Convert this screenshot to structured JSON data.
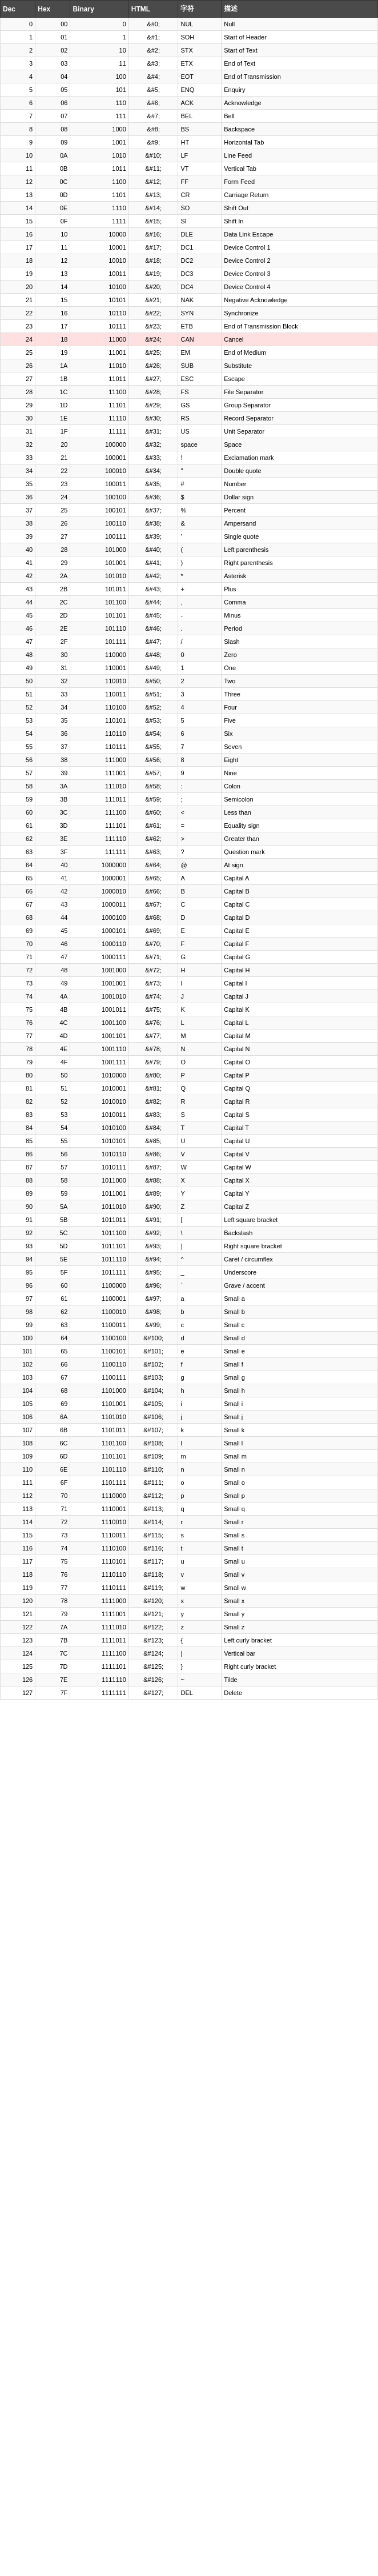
{
  "table": {
    "headers": [
      "Dec",
      "Hex",
      "Binary",
      "HTML",
      "字符",
      "描述"
    ],
    "rows": [
      [
        0,
        "00",
        "0",
        "&#0;",
        "NUL",
        "Null"
      ],
      [
        1,
        "01",
        "1",
        "&#1;",
        "SOH",
        "Start of Header"
      ],
      [
        2,
        "02",
        "10",
        "&#2;",
        "STX",
        "Start of Text"
      ],
      [
        3,
        "03",
        "11",
        "&#3;",
        "ETX",
        "End of Text"
      ],
      [
        4,
        "04",
        "100",
        "&#4;",
        "EOT",
        "End of Transmission"
      ],
      [
        5,
        "05",
        "101",
        "&#5;",
        "ENQ",
        "Enquiry"
      ],
      [
        6,
        "06",
        "110",
        "&#6;",
        "ACK",
        "Acknowledge"
      ],
      [
        7,
        "07",
        "111",
        "&#7;",
        "BEL",
        "Bell"
      ],
      [
        8,
        "08",
        "1000",
        "&#8;",
        "BS",
        "Backspace"
      ],
      [
        9,
        "09",
        "1001",
        "&#9;",
        "HT",
        "Horizontal Tab"
      ],
      [
        10,
        "0A",
        "1010",
        "&#10;",
        "LF",
        "Line Feed"
      ],
      [
        11,
        "0B",
        "1011",
        "&#11;",
        "VT",
        "Vertical Tab"
      ],
      [
        12,
        "0C",
        "1100",
        "&#12;",
        "FF",
        "Form Feed"
      ],
      [
        13,
        "0D",
        "1101",
        "&#13;",
        "CR",
        "Carriage Return"
      ],
      [
        14,
        "0E",
        "1110",
        "&#14;",
        "SO",
        "Shift Out"
      ],
      [
        15,
        "0F",
        "1111",
        "&#15;",
        "SI",
        "Shift In"
      ],
      [
        16,
        "10",
        "10000",
        "&#16;",
        "DLE",
        "Data Link Escape"
      ],
      [
        17,
        "11",
        "10001",
        "&#17;",
        "DC1",
        "Device Control 1"
      ],
      [
        18,
        "12",
        "10010",
        "&#18;",
        "DC2",
        "Device Control 2"
      ],
      [
        19,
        "13",
        "10011",
        "&#19;",
        "DC3",
        "Device Control 3"
      ],
      [
        20,
        "14",
        "10100",
        "&#20;",
        "DC4",
        "Device Control 4"
      ],
      [
        21,
        "15",
        "10101",
        "&#21;",
        "NAK",
        "Negative Acknowledge"
      ],
      [
        22,
        "16",
        "10110",
        "&#22;",
        "SYN",
        "Synchronize"
      ],
      [
        23,
        "17",
        "10111",
        "&#23;",
        "ETB",
        "End of Transmission Block"
      ],
      [
        24,
        "18",
        "11000",
        "&#24;",
        "CAN",
        "Cancel"
      ],
      [
        25,
        "19",
        "11001",
        "&#25;",
        "EM",
        "End of Medium"
      ],
      [
        26,
        "1A",
        "11010",
        "&#26;",
        "SUB",
        "Substitute"
      ],
      [
        27,
        "1B",
        "11011",
        "&#27;",
        "ESC",
        "Escape"
      ],
      [
        28,
        "1C",
        "11100",
        "&#28;",
        "FS",
        "File Separator"
      ],
      [
        29,
        "1D",
        "11101",
        "&#29;",
        "GS",
        "Group Separator"
      ],
      [
        30,
        "1E",
        "11110",
        "&#30;",
        "RS",
        "Record Separator"
      ],
      [
        31,
        "1F",
        "11111",
        "&#31;",
        "US",
        "Unit Separator"
      ],
      [
        32,
        "20",
        "100000",
        "&#32;",
        "space",
        "Space"
      ],
      [
        33,
        "21",
        "100001",
        "&#33;",
        "!",
        "Exclamation mark"
      ],
      [
        34,
        "22",
        "100010",
        "&#34;",
        "\"",
        "Double quote"
      ],
      [
        35,
        "23",
        "100011",
        "&#35;",
        "#",
        "Number"
      ],
      [
        36,
        "24",
        "100100",
        "&#36;",
        "$",
        "Dollar sign"
      ],
      [
        37,
        "25",
        "100101",
        "&#37;",
        "%",
        "Percent"
      ],
      [
        38,
        "26",
        "100110",
        "&#38;",
        "&",
        "Ampersand"
      ],
      [
        39,
        "27",
        "100111",
        "&#39;",
        "'",
        "Single quote"
      ],
      [
        40,
        "28",
        "101000",
        "&#40;",
        "(",
        "Left parenthesis"
      ],
      [
        41,
        "29",
        "101001",
        "&#41;",
        ")",
        "Right parenthesis"
      ],
      [
        42,
        "2A",
        "101010",
        "&#42;",
        "*",
        "Asterisk"
      ],
      [
        43,
        "2B",
        "101011",
        "&#43;",
        "+",
        "Plus"
      ],
      [
        44,
        "2C",
        "101100",
        "&#44;",
        ",",
        "Comma"
      ],
      [
        45,
        "2D",
        "101101",
        "&#45;",
        "-",
        "Minus"
      ],
      [
        46,
        "2E",
        "101110",
        "&#46;",
        ".",
        "Period"
      ],
      [
        47,
        "2F",
        "101111",
        "&#47;",
        "/",
        "Slash"
      ],
      [
        48,
        "30",
        "110000",
        "&#48;",
        "0",
        "Zero"
      ],
      [
        49,
        "31",
        "110001",
        "&#49;",
        "1",
        "One"
      ],
      [
        50,
        "32",
        "110010",
        "&#50;",
        "2",
        "Two"
      ],
      [
        51,
        "33",
        "110011",
        "&#51;",
        "3",
        "Three"
      ],
      [
        52,
        "34",
        "110100",
        "&#52;",
        "4",
        "Four"
      ],
      [
        53,
        "35",
        "110101",
        "&#53;",
        "5",
        "Five"
      ],
      [
        54,
        "36",
        "110110",
        "&#54;",
        "6",
        "Six"
      ],
      [
        55,
        "37",
        "110111",
        "&#55;",
        "7",
        "Seven"
      ],
      [
        56,
        "38",
        "111000",
        "&#56;",
        "8",
        "Eight"
      ],
      [
        57,
        "39",
        "111001",
        "&#57;",
        "9",
        "Nine"
      ],
      [
        58,
        "3A",
        "111010",
        "&#58;",
        ":",
        "Colon"
      ],
      [
        59,
        "3B",
        "111011",
        "&#59;",
        ";",
        "Semicolon"
      ],
      [
        60,
        "3C",
        "111100",
        "&#60;",
        "<",
        "Less than"
      ],
      [
        61,
        "3D",
        "111101",
        "&#61;",
        "=",
        "Equality sign"
      ],
      [
        62,
        "3E",
        "111110",
        "&#62;",
        ">",
        "Greater than"
      ],
      [
        63,
        "3F",
        "111111",
        "&#63;",
        "?",
        "Question mark"
      ],
      [
        64,
        "40",
        "1000000",
        "&#64;",
        "@",
        "At sign"
      ],
      [
        65,
        "41",
        "1000001",
        "&#65;",
        "A",
        "Capital A"
      ],
      [
        66,
        "42",
        "1000010",
        "&#66;",
        "B",
        "Capital B"
      ],
      [
        67,
        "43",
        "1000011",
        "&#67;",
        "C",
        "Capital C"
      ],
      [
        68,
        "44",
        "1000100",
        "&#68;",
        "D",
        "Capital D"
      ],
      [
        69,
        "45",
        "1000101",
        "&#69;",
        "E",
        "Capital E"
      ],
      [
        70,
        "46",
        "1000110",
        "&#70;",
        "F",
        "Capital F"
      ],
      [
        71,
        "47",
        "1000111",
        "&#71;",
        "G",
        "Capital G"
      ],
      [
        72,
        "48",
        "1001000",
        "&#72;",
        "H",
        "Capital H"
      ],
      [
        73,
        "49",
        "1001001",
        "&#73;",
        "I",
        "Capital I"
      ],
      [
        74,
        "4A",
        "1001010",
        "&#74;",
        "J",
        "Capital J"
      ],
      [
        75,
        "4B",
        "1001011",
        "&#75;",
        "K",
        "Capital K"
      ],
      [
        76,
        "4C",
        "1001100",
        "&#76;",
        "L",
        "Capital L"
      ],
      [
        77,
        "4D",
        "1001101",
        "&#77;",
        "M",
        "Capital M"
      ],
      [
        78,
        "4E",
        "1001110",
        "&#78;",
        "N",
        "Capital N"
      ],
      [
        79,
        "4F",
        "1001111",
        "&#79;",
        "O",
        "Capital O"
      ],
      [
        80,
        "50",
        "1010000",
        "&#80;",
        "P",
        "Capital P"
      ],
      [
        81,
        "51",
        "1010001",
        "&#81;",
        "Q",
        "Capital Q"
      ],
      [
        82,
        "52",
        "1010010",
        "&#82;",
        "R",
        "Capital R"
      ],
      [
        83,
        "53",
        "1010011",
        "&#83;",
        "S",
        "Capital S"
      ],
      [
        84,
        "54",
        "1010100",
        "&#84;",
        "T",
        "Capital T"
      ],
      [
        85,
        "55",
        "1010101",
        "&#85;",
        "U",
        "Capital U"
      ],
      [
        86,
        "56",
        "1010110",
        "&#86;",
        "V",
        "Capital V"
      ],
      [
        87,
        "57",
        "1010111",
        "&#87;",
        "W",
        "Capital W"
      ],
      [
        88,
        "58",
        "1011000",
        "&#88;",
        "X",
        "Capital X"
      ],
      [
        89,
        "59",
        "1011001",
        "&#89;",
        "Y",
        "Capital Y"
      ],
      [
        90,
        "5A",
        "1011010",
        "&#90;",
        "Z",
        "Capital Z"
      ],
      [
        91,
        "5B",
        "1011011",
        "&#91;",
        "[",
        "Left square bracket"
      ],
      [
        92,
        "5C",
        "1011100",
        "&#92;",
        "\\",
        "Backslash"
      ],
      [
        93,
        "5D",
        "1011101",
        "&#93;",
        "]",
        "Right square bracket"
      ],
      [
        94,
        "5E",
        "1011110",
        "&#94;",
        "^",
        "Caret / circumflex"
      ],
      [
        95,
        "5F",
        "1011111",
        "&#95;",
        "_",
        "Underscore"
      ],
      [
        96,
        "60",
        "1100000",
        "&#96;",
        "`",
        "Grave / accent"
      ],
      [
        97,
        "61",
        "1100001",
        "&#97;",
        "a",
        "Small a"
      ],
      [
        98,
        "62",
        "1100010",
        "&#98;",
        "b",
        "Small b"
      ],
      [
        99,
        "63",
        "1100011",
        "&#99;",
        "c",
        "Small c"
      ],
      [
        100,
        "64",
        "1100100",
        "&#100;",
        "d",
        "Small d"
      ],
      [
        101,
        "65",
        "1100101",
        "&#101;",
        "e",
        "Small e"
      ],
      [
        102,
        "66",
        "1100110",
        "&#102;",
        "f",
        "Small f"
      ],
      [
        103,
        "67",
        "1100111",
        "&#103;",
        "g",
        "Small g"
      ],
      [
        104,
        "68",
        "1101000",
        "&#104;",
        "h",
        "Small h"
      ],
      [
        105,
        "69",
        "1101001",
        "&#105;",
        "i",
        "Small i"
      ],
      [
        106,
        "6A",
        "1101010",
        "&#106;",
        "j",
        "Small j"
      ],
      [
        107,
        "6B",
        "1101011",
        "&#107;",
        "k",
        "Small k"
      ],
      [
        108,
        "6C",
        "1101100",
        "&#108;",
        "l",
        "Small l"
      ],
      [
        109,
        "6D",
        "1101101",
        "&#109;",
        "m",
        "Small m"
      ],
      [
        110,
        "6E",
        "1101110",
        "&#110;",
        "n",
        "Small n"
      ],
      [
        111,
        "6F",
        "1101111",
        "&#111;",
        "o",
        "Small o"
      ],
      [
        112,
        "70",
        "1110000",
        "&#112;",
        "p",
        "Small p"
      ],
      [
        113,
        "71",
        "1110001",
        "&#113;",
        "q",
        "Small q"
      ],
      [
        114,
        "72",
        "1110010",
        "&#114;",
        "r",
        "Small r"
      ],
      [
        115,
        "73",
        "1110011",
        "&#115;",
        "s",
        "Small s"
      ],
      [
        116,
        "74",
        "1110100",
        "&#116;",
        "t",
        "Small t"
      ],
      [
        117,
        "75",
        "1110101",
        "&#117;",
        "u",
        "Small u"
      ],
      [
        118,
        "76",
        "1110110",
        "&#118;",
        "v",
        "Small v"
      ],
      [
        119,
        "77",
        "1110111",
        "&#119;",
        "w",
        "Small w"
      ],
      [
        120,
        "78",
        "1111000",
        "&#120;",
        "x",
        "Small x"
      ],
      [
        121,
        "79",
        "1111001",
        "&#121;",
        "y",
        "Small y"
      ],
      [
        122,
        "7A",
        "1111010",
        "&#122;",
        "z",
        "Small z"
      ],
      [
        123,
        "7B",
        "1111011",
        "&#123;",
        "{",
        "Left curly bracket"
      ],
      [
        124,
        "7C",
        "1111100",
        "&#124;",
        "|",
        "Vertical bar"
      ],
      [
        125,
        "7D",
        "1111101",
        "&#125;",
        "}",
        "Right curly bracket"
      ],
      [
        126,
        "7E",
        "1111110",
        "&#126;",
        "~",
        "Tilde"
      ],
      [
        127,
        "7F",
        "1111111",
        "&#127;",
        "DEL",
        "Delete"
      ]
    ],
    "highlight_row_index": 24
  }
}
